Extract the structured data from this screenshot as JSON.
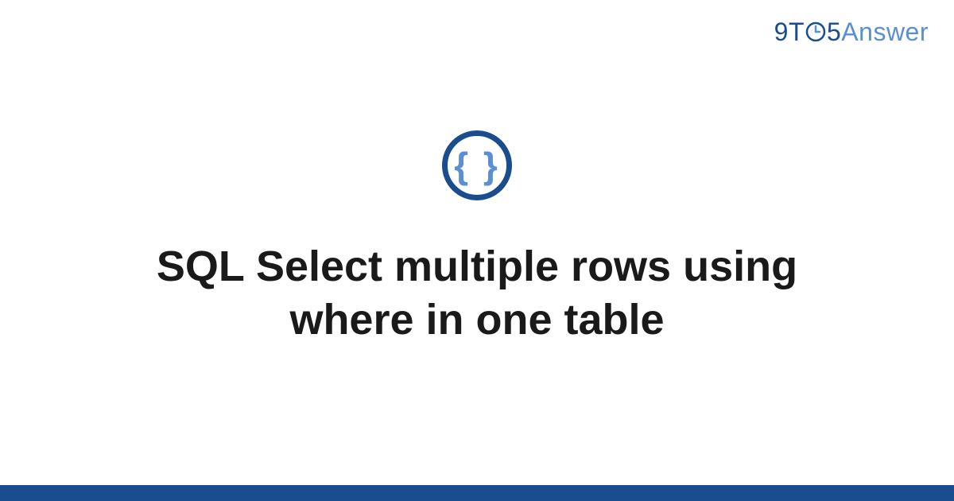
{
  "logo": {
    "part1": "9T",
    "part2": "5",
    "part3": "Answer"
  },
  "icon": {
    "symbol": "{ }",
    "name": "code-braces"
  },
  "title": "SQL Select multiple rows using where in one table",
  "colors": {
    "primary": "#1a4d8f",
    "secondary": "#5a8fd4"
  }
}
